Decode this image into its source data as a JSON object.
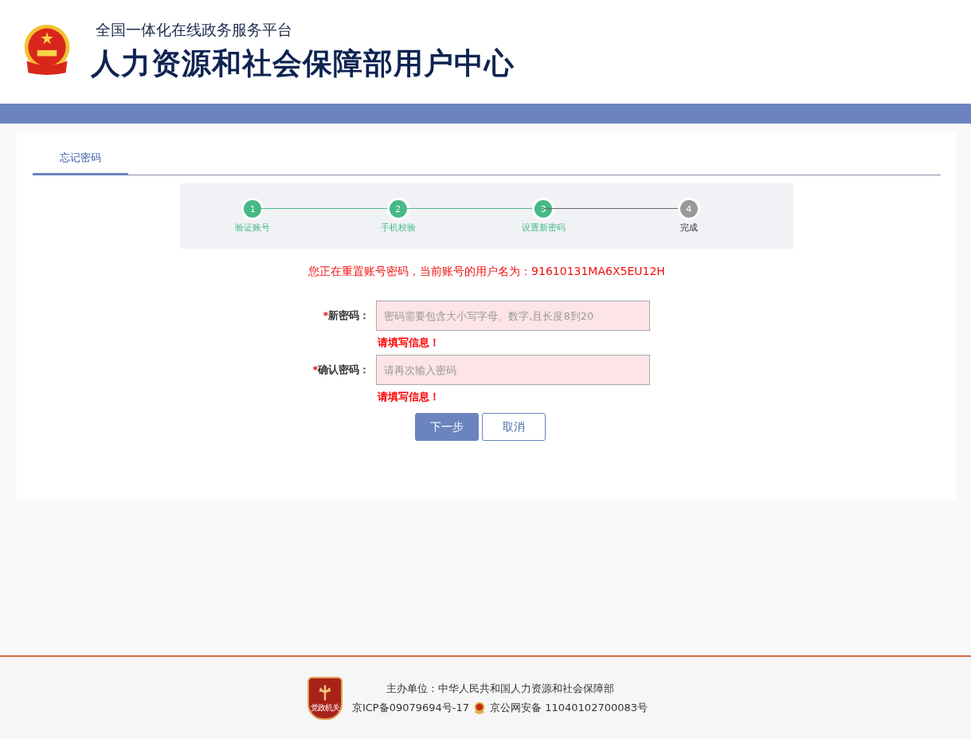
{
  "header": {
    "subtitle": "全国一体化在线政务服务平台",
    "title": "人力资源和社会保障部用户中心"
  },
  "tabs": [
    {
      "label": "忘记密码",
      "selected": true
    }
  ],
  "steps": [
    {
      "number": "1",
      "label": "验证账号",
      "done": true
    },
    {
      "number": "2",
      "label": "手机校验",
      "done": true
    },
    {
      "number": "3",
      "label": "设置新密码",
      "done": true
    },
    {
      "number": "4",
      "label": "完成",
      "done": false
    }
  ],
  "notice": "您正在重置账号密码，当前账号的用户名为：91610131MA6X5EU12H",
  "fields": [
    {
      "required_mark": "*",
      "label": "新密码：",
      "placeholder": "密码需要包含大小写字母、数字,且长度8到20",
      "error": "请填写信息！"
    },
    {
      "required_mark": "*",
      "label": "确认密码：",
      "placeholder": "请再次输入密码",
      "error": "请填写信息！"
    }
  ],
  "buttons": [
    {
      "label": "下一步",
      "kind": "primary"
    },
    {
      "label": "取消",
      "kind": "secondary"
    }
  ],
  "footer": {
    "badge": "党政机关",
    "sponsor": "主办单位：中华人民共和国人力资源和社会保障部",
    "icp": "京ICP备09079694号-17",
    "security": "京公网安备 11040102700083号"
  }
}
